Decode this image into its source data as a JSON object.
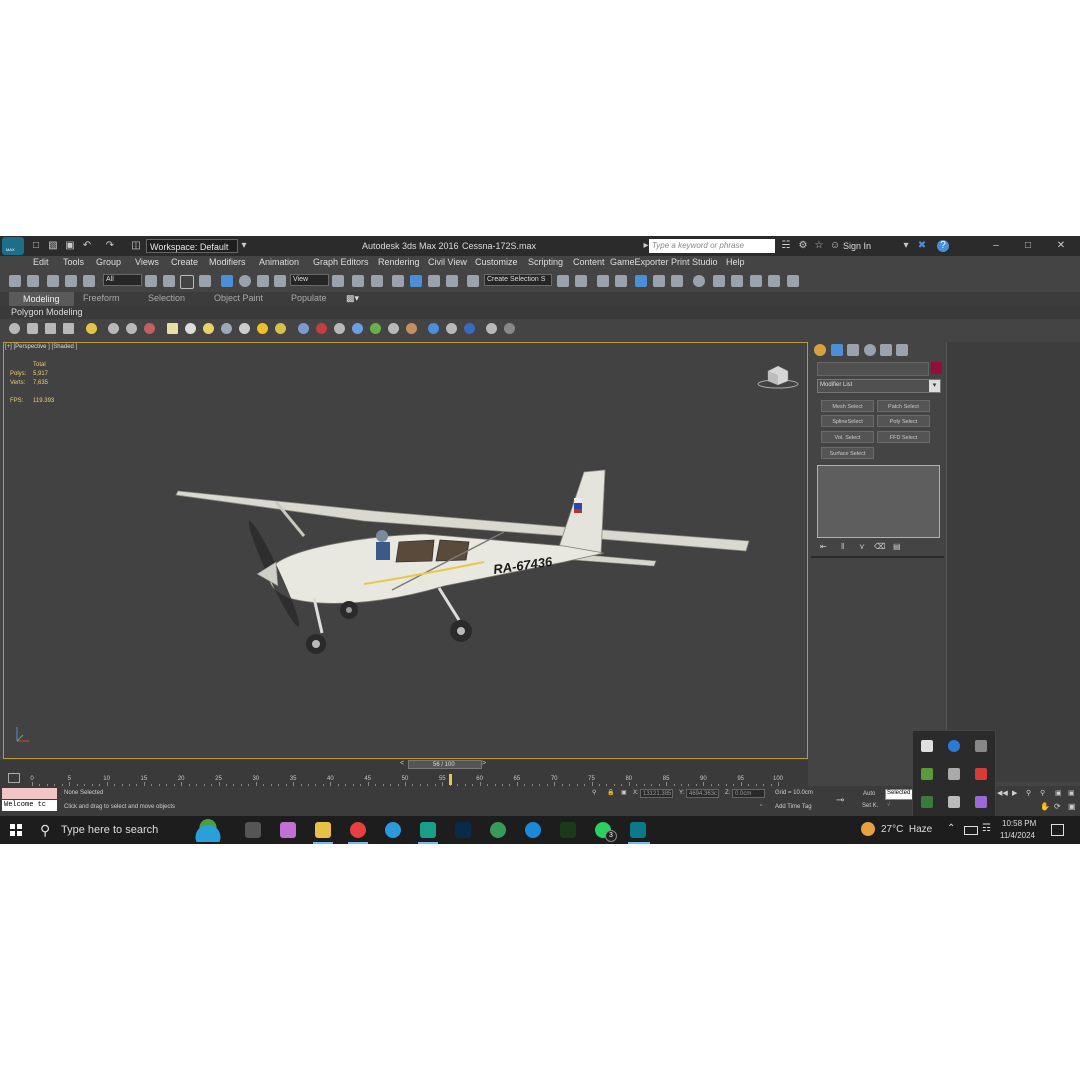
{
  "window": {
    "title": "Autodesk 3ds Max 2016",
    "filename": "Cessna-172S.max",
    "workspace": "Workspace: Default",
    "search_placeholder": "Type a keyword or phrase",
    "sign_in": "Sign In",
    "logo_text": "MAX"
  },
  "menu": [
    "Edit",
    "Tools",
    "Group",
    "Views",
    "Create",
    "Modifiers",
    "Animation",
    "Graph Editors",
    "Rendering",
    "Civil View",
    "Customize",
    "Scripting",
    "Content",
    "GameExporter",
    "Print Studio",
    "Help"
  ],
  "toolbar": {
    "filter": "All",
    "ref_coord": "View",
    "selection_set": "Create Selection S"
  },
  "ribbon": {
    "tabs": [
      "Modeling",
      "Freeform",
      "Selection",
      "Object Paint",
      "Populate"
    ],
    "sub_label": "Polygon Modeling"
  },
  "viewport": {
    "label": "[+] [Perspective ] [Shaded ]",
    "stats": {
      "total_label": "Total",
      "polys_label": "Polys:",
      "polys": "5,917",
      "verts_label": "Verts:",
      "verts": "7,635",
      "fps_label": "FPS:",
      "fps": "119.393"
    },
    "tail_number": "RA-67436"
  },
  "command_panel": {
    "modifier_list": "Modifier List",
    "buttons": [
      "Mesh Select",
      "Patch Select",
      "SplineSelect",
      "Poly Select",
      "Vol. Select",
      "FFD Select",
      "Surface Select"
    ]
  },
  "timeline": {
    "frame_display": "56 / 100",
    "ticks": [
      "0",
      "5",
      "10",
      "15",
      "20",
      "25",
      "30",
      "35",
      "40",
      "45",
      "50",
      "55",
      "60",
      "65",
      "70",
      "75",
      "80",
      "85",
      "90",
      "95",
      "100"
    ],
    "current_frame": 56
  },
  "status": {
    "welcome": "Welcome tc",
    "selection": "None Selected",
    "prompt": "Click and drag to select and move objects",
    "x_label": "X:",
    "x_value": "13121.385",
    "y_label": "Y:",
    "y_value": "4694.363c",
    "z_label": "Z:",
    "z_value": "0.0cm",
    "grid": "Grid = 10.0cm",
    "add_time_tag": "Add Time Tag",
    "auto": "Auto",
    "selected": "Selected",
    "set_k": "Set K."
  },
  "taskbar": {
    "search": "Type here to search",
    "weather": "27°C  Haze",
    "time": "10:58 PM",
    "date": "11/4/2024",
    "whatsapp_badge": "3"
  },
  "colors": {
    "accent": "#4a8fd8",
    "viewport_border": "#b89b3a",
    "stats_text": "#e8d36a"
  }
}
